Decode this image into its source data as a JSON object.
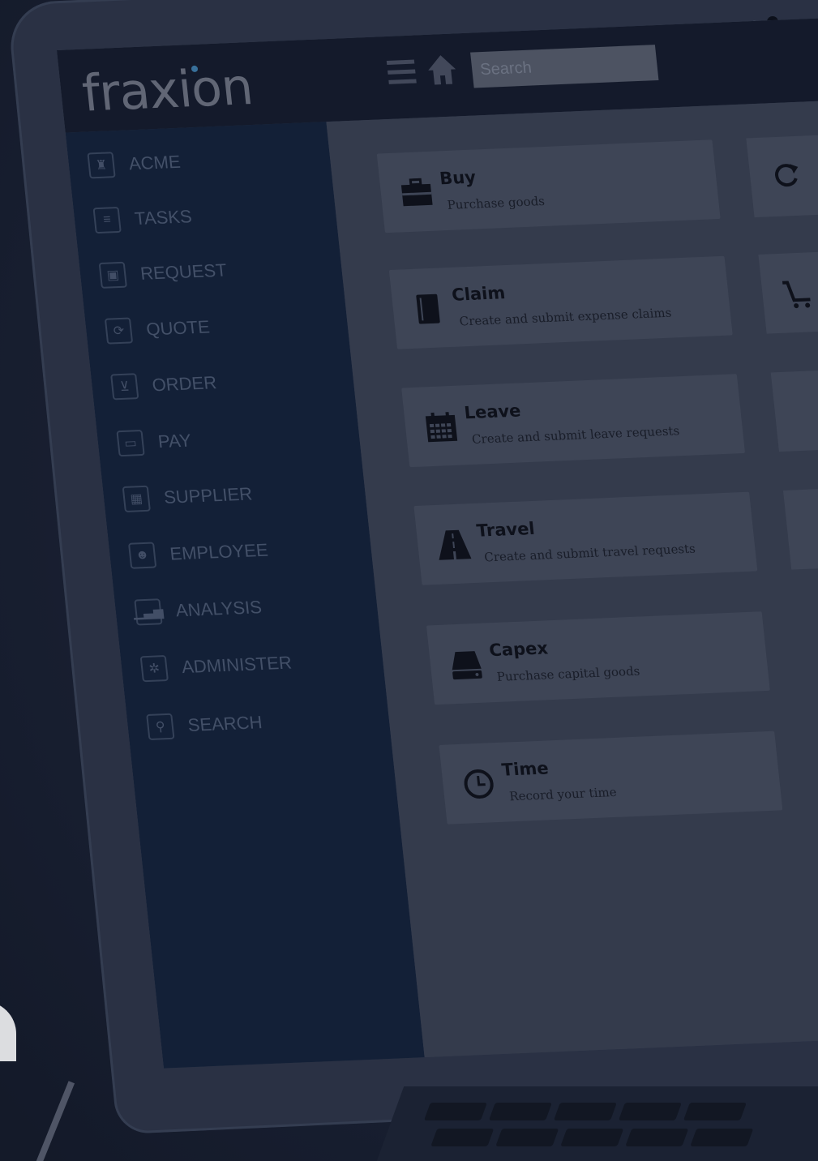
{
  "app": {
    "logo_text": "fraxion",
    "search_placeholder": "Search"
  },
  "sidebar": {
    "items": [
      {
        "label": "ACME",
        "icon": "building-icon"
      },
      {
        "label": "TASKS",
        "icon": "tasks-icon"
      },
      {
        "label": "REQUEST",
        "icon": "briefcase-icon"
      },
      {
        "label": "QUOTE",
        "icon": "refresh-icon"
      },
      {
        "label": "ORDER",
        "icon": "cart-icon"
      },
      {
        "label": "PAY",
        "icon": "credit-card-icon"
      },
      {
        "label": "SUPPLIER",
        "icon": "grid-icon"
      },
      {
        "label": "EMPLOYEE",
        "icon": "user-icon"
      },
      {
        "label": "ANALYSIS",
        "icon": "bar-chart-icon"
      },
      {
        "label": "ADMINISTER",
        "icon": "gear-icon"
      },
      {
        "label": "SEARCH",
        "icon": "search-icon"
      }
    ]
  },
  "cards": [
    {
      "title": "Buy",
      "desc": "Purchase goods",
      "icon": "briefcase-icon"
    },
    {
      "title": "Claim",
      "desc": "Create and submit expense claims",
      "icon": "book-icon"
    },
    {
      "title": "Leave",
      "desc": "Create and submit leave requests",
      "icon": "calendar-icon"
    },
    {
      "title": "Travel",
      "desc": "Create and submit travel requests",
      "icon": "road-icon"
    },
    {
      "title": "Capex",
      "desc": "Purchase capital goods",
      "icon": "hard-drive-icon"
    },
    {
      "title": "Time",
      "desc": "Record your time",
      "icon": "clock-icon"
    }
  ],
  "right_cards": [
    {
      "icon": "refresh-icon"
    },
    {
      "icon": "cart-icon"
    }
  ],
  "colors": {
    "sidebar_bg": "#132139",
    "content_bg": "#3a4152",
    "topbar_bg": "#141b2b",
    "card_bg": "#464d5d"
  }
}
